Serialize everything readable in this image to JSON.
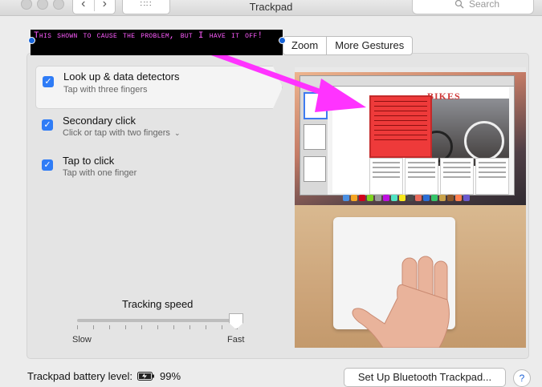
{
  "window": {
    "title": "Trackpad"
  },
  "toolbar": {
    "search_placeholder": "Search"
  },
  "tabs": [
    "Zoom",
    "More Gestures"
  ],
  "options": [
    {
      "title": "Look up & data detectors",
      "subtitle": "Tap with three fingers",
      "checked": true,
      "selected": true
    },
    {
      "title": "Secondary click",
      "subtitle": "Click or tap with two fingers",
      "checked": true,
      "has_dropdown": true
    },
    {
      "title": "Tap to click",
      "subtitle": "Tap with one finger",
      "checked": true
    }
  ],
  "tracking": {
    "label": "Tracking speed",
    "slow": "Slow",
    "fast": "Fast",
    "value_fraction": 0.99
  },
  "annotation": {
    "text": "This shown to cause the problem, but I have it off!",
    "color": "#ff33ff"
  },
  "preview": {
    "heading": "BIKES"
  },
  "footer": {
    "battery_label": "Trackpad battery level:",
    "battery_value": "99%",
    "setup_button": "Set Up Bluetooth Trackpad...",
    "help": "?"
  },
  "colors": {
    "accent": "#2f7cf6",
    "annotation": "#ff33ff"
  }
}
